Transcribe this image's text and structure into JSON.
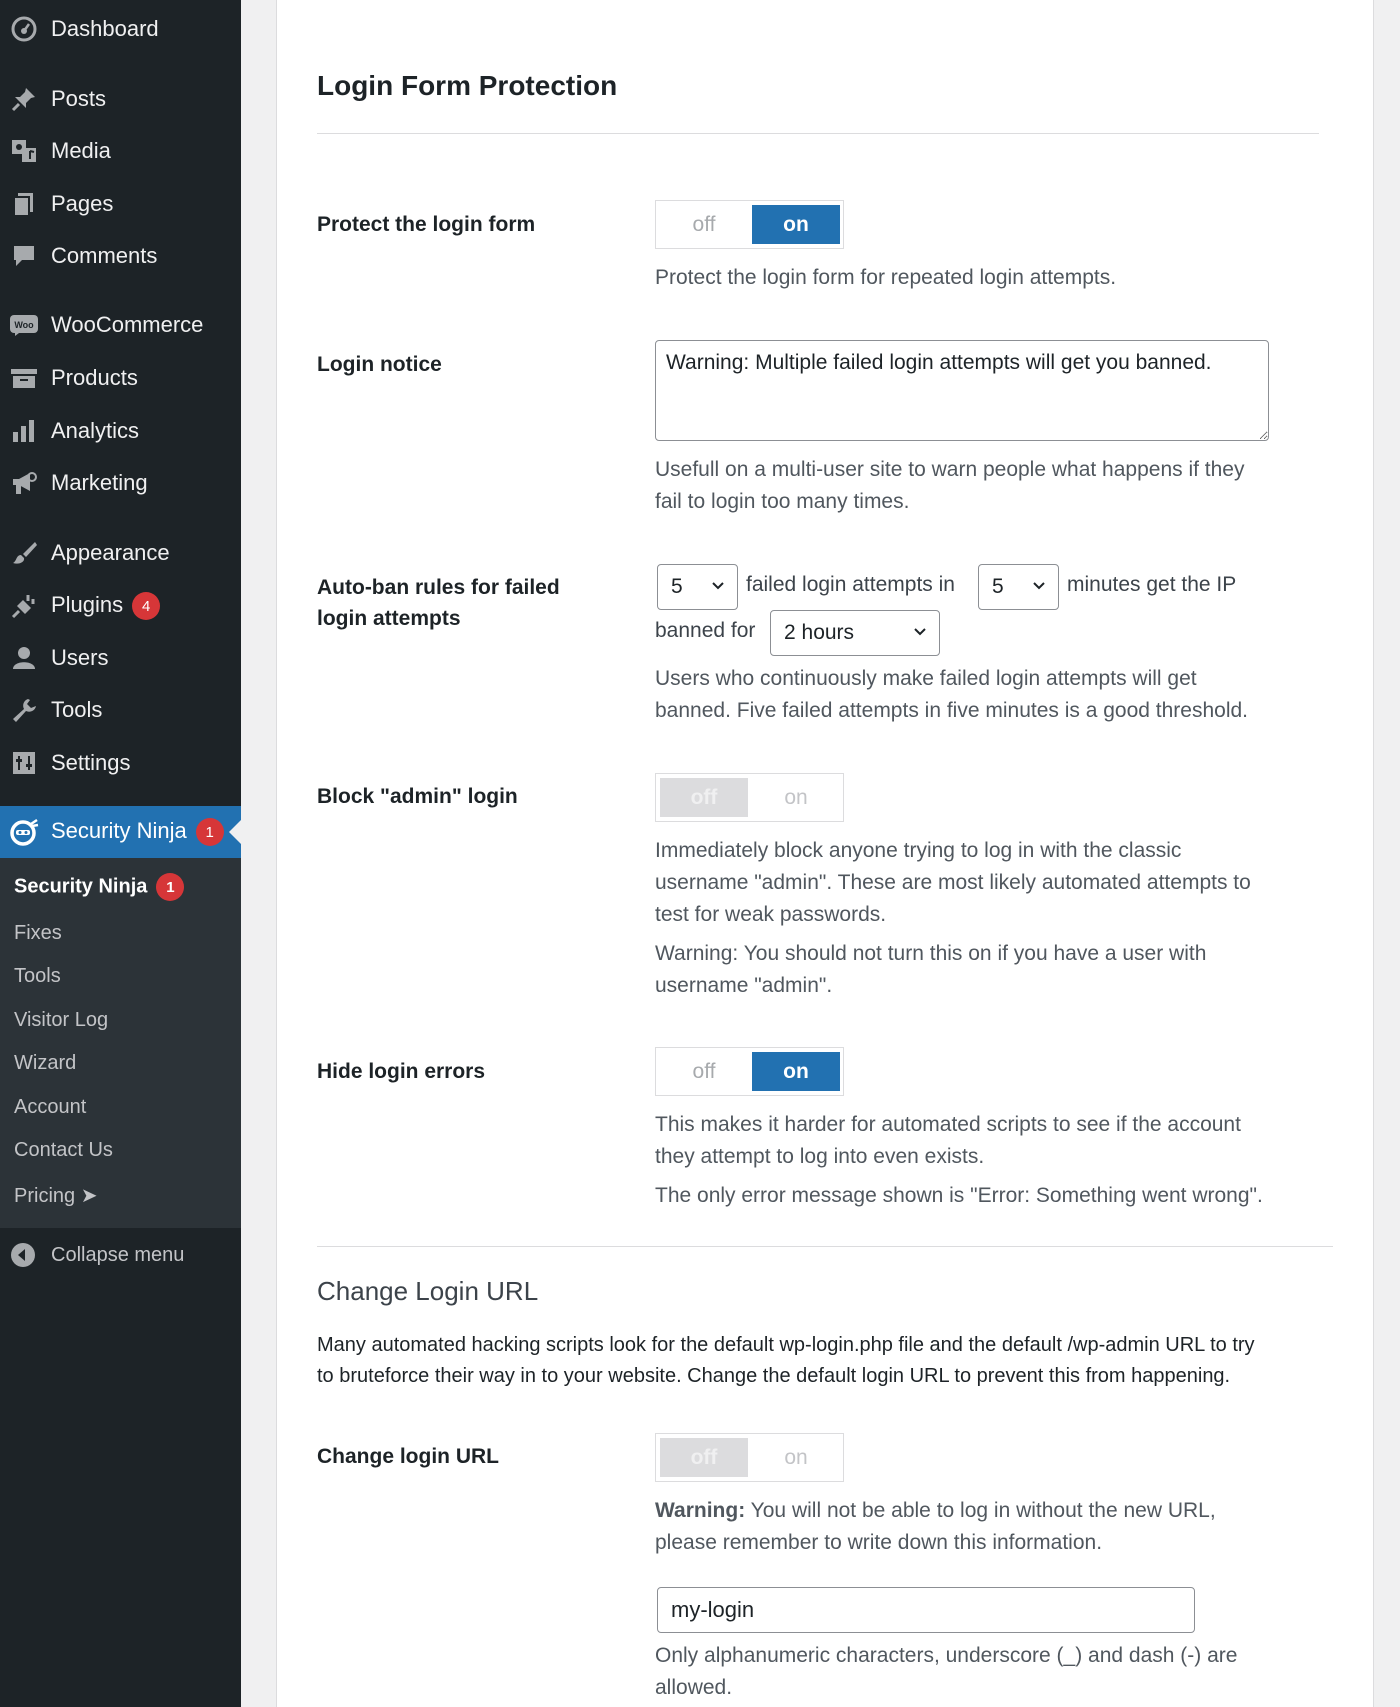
{
  "sidebar": {
    "menu": [
      {
        "label": "Dashboard",
        "icon": "dashboard-icon"
      },
      {
        "label": "Posts",
        "icon": "pin-icon"
      },
      {
        "label": "Media",
        "icon": "media-icon"
      },
      {
        "label": "Pages",
        "icon": "pages-icon"
      },
      {
        "label": "Comments",
        "icon": "comment-icon"
      },
      {
        "label": "WooCommerce",
        "icon": "woo-icon"
      },
      {
        "label": "Products",
        "icon": "archive-icon"
      },
      {
        "label": "Analytics",
        "icon": "bar-chart-icon"
      },
      {
        "label": "Marketing",
        "icon": "megaphone-icon"
      },
      {
        "label": "Appearance",
        "icon": "brush-icon"
      },
      {
        "label": "Plugins",
        "icon": "plug-icon",
        "badge": "4"
      },
      {
        "label": "Users",
        "icon": "user-icon"
      },
      {
        "label": "Tools",
        "icon": "wrench-icon"
      },
      {
        "label": "Settings",
        "icon": "settings-icon"
      },
      {
        "label": "Security Ninja",
        "icon": "ninja-icon",
        "badge": "1"
      }
    ],
    "submenu": [
      {
        "label": "Security Ninja",
        "badge": "1"
      },
      {
        "label": "Fixes"
      },
      {
        "label": "Tools"
      },
      {
        "label": "Visitor Log"
      },
      {
        "label": "Wizard"
      },
      {
        "label": "Account"
      },
      {
        "label": "Contact Us"
      },
      {
        "label": "Pricing",
        "suffix": "➤"
      }
    ],
    "collapse_label": "Collapse menu"
  },
  "main": {
    "title": "Login Form Protection",
    "protect": {
      "label": "Protect the login form",
      "off": "off",
      "on": "on",
      "desc": "Protect the login form for repeated login attempts."
    },
    "notice": {
      "label": "Login notice",
      "value": "Warning: Multiple failed login attempts will get you banned.",
      "desc_1": "Usefull on a multi-user site to warn people what happens if they",
      "desc_2": "fail to login too many times."
    },
    "autoban": {
      "label_1": "Auto-ban rules for failed",
      "label_2": "login attempts",
      "attempts_value": "5",
      "text_failed": "failed login attempts in",
      "minutes_value": "5",
      "text_minutes": "minutes get the IP",
      "text_banned": "banned for",
      "ban_value": "2 hours",
      "desc_1": "Users who continuously make failed login attempts will get",
      "desc_2": "banned. Five failed attempts in five minutes is a good threshold."
    },
    "block_admin": {
      "label": "Block \"admin\" login",
      "off": "off",
      "on": "on",
      "desc_1": "Immediately block anyone trying to log in with the classic",
      "desc_2": "username \"admin\". These are most likely automated attempts to",
      "desc_3": "test for weak passwords.",
      "warn_1": "Warning: You should not turn this on if you have a user with",
      "warn_2": "username \"admin\"."
    },
    "hide_errors": {
      "label": "Hide login errors",
      "off": "off",
      "on": "on",
      "desc_1": "This makes it harder for automated scripts to see if the account",
      "desc_2": "they attempt to log into even exists.",
      "desc_3": "The only error message shown is \"Error: Something went wrong\"."
    },
    "change_url_section": {
      "title": "Change Login URL",
      "para_1": "Many automated hacking scripts look for the default wp-login.php file and the default /wp-admin URL to try",
      "para_2": "to bruteforce their way in to your website. Change the default login URL to prevent this from happening."
    },
    "change_url": {
      "label": "Change login URL",
      "off": "off",
      "on": "on",
      "warn_strong": "Warning:",
      "warn_rest": " You will not be able to log in without the new URL,",
      "warn_2": "please remember to write down this information.",
      "input_value": "my-login",
      "desc_1": "Only alphanumeric characters, underscore (_) and dash (-) are",
      "desc_2": "allowed."
    }
  }
}
